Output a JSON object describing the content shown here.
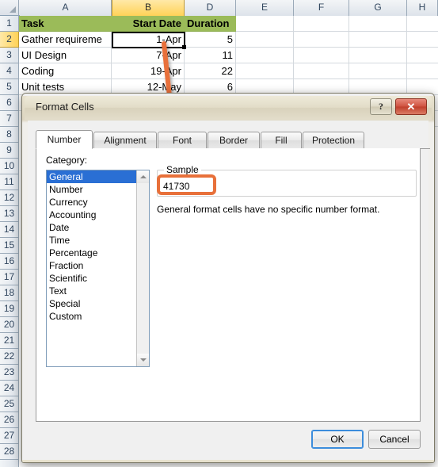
{
  "spreadsheet": {
    "column_headers": [
      "A",
      "B",
      "D",
      "E",
      "F",
      "G",
      "H"
    ],
    "selected_column": "B",
    "selected_row": "2",
    "row_headers": [
      "1",
      "2",
      "3",
      "4",
      "5",
      "6",
      "7",
      "8",
      "9",
      "10",
      "11",
      "12",
      "13",
      "14",
      "15",
      "16",
      "17",
      "18",
      "19",
      "20",
      "21",
      "22",
      "23",
      "24",
      "25",
      "26",
      "27",
      "28"
    ],
    "header_row": {
      "task": "Task",
      "start_date": "Start Date",
      "duration": "Duration"
    },
    "rows": [
      {
        "task": "Gather requireme",
        "start_date": "1-Apr",
        "duration": "5"
      },
      {
        "task": "UI Design",
        "start_date": "7-Apr",
        "duration": "11"
      },
      {
        "task": "Coding",
        "start_date": "19-Apr",
        "duration": "22"
      },
      {
        "task": "Unit tests",
        "start_date": "12-May",
        "duration": "6"
      }
    ],
    "header_fill_color": "#9BBB59",
    "selected_cell": "B2"
  },
  "dialog": {
    "title": "Format Cells",
    "help_button": "?",
    "close_button": "✕",
    "tabs": [
      {
        "label": "Number",
        "active": true
      },
      {
        "label": "Alignment",
        "active": false
      },
      {
        "label": "Font",
        "active": false
      },
      {
        "label": "Border",
        "active": false
      },
      {
        "label": "Fill",
        "active": false
      },
      {
        "label": "Protection",
        "active": false
      }
    ],
    "category_label": "Category:",
    "categories": [
      "General",
      "Number",
      "Currency",
      "Accounting",
      "Date",
      "Time",
      "Percentage",
      "Fraction",
      "Scientific",
      "Text",
      "Special",
      "Custom"
    ],
    "selected_category": "General",
    "sample_label": "Sample",
    "sample_value": "41730",
    "description": "General format cells have no specific number format.",
    "ok_label": "OK",
    "cancel_label": "Cancel"
  },
  "annotation": {
    "accent_color": "#E8703A",
    "arrow_from": "B2 cell",
    "arrow_to": "Sample value box"
  }
}
